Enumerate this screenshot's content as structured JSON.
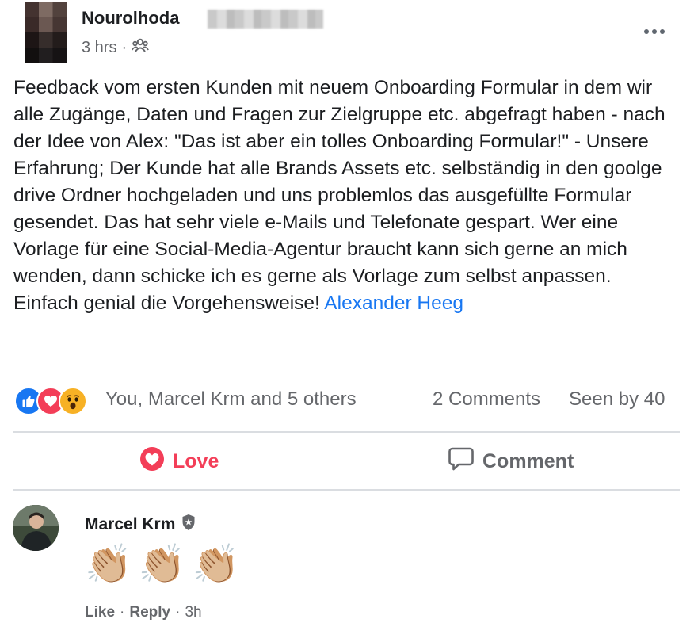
{
  "post": {
    "author": "Nourolhoda",
    "time": "3 hrs",
    "separator": "·",
    "text_main": "Feedback vom ersten Kunden mit neuem Onboarding Formular in dem wir alle Zugänge, Daten und Fragen zur Zielgruppe etc. abgefragt haben - nach der Idee von Alex: \"Das ist aber ein tolles Onboarding Formular!\" - Unsere Erfahrung; Der Kunde hat alle Brands Assets etc. selbständig in den goolge drive Ordner hochgeladen und uns problemlos das ausgefüllte Formular gesendet. Das hat sehr viele e-Mails und Telefonate gespart. Wer eine Vorlage für eine Social-Media-Agentur braucht kann sich gerne an mich wenden, dann schicke ich es gerne als Vorlage zum selbst anpassen. Einfach genial die Vorgehensweise!",
    "mention": "Alexander Heeg"
  },
  "stats": {
    "reactions_text": "You, Marcel Krm and 5 others",
    "comments": "2 Comments",
    "seen": "Seen by 40"
  },
  "actions": {
    "love_label": "Love",
    "comment_label": "Comment"
  },
  "comment": {
    "author": "Marcel Krm",
    "emoji": [
      "👏🏼",
      "👏🏼",
      "👏🏼"
    ],
    "like_label": "Like",
    "reply_label": "Reply",
    "time": "3h",
    "separator": "·"
  },
  "colors": {
    "love": "#f33e58",
    "link": "#1877f2",
    "secondary_text": "#65676b",
    "like_blue": "#1877f2",
    "wow_yellow": "#f7b125"
  },
  "icons": {
    "group": "group-privacy-icon",
    "more": "more-options-icon",
    "like": "like-reaction-icon",
    "love": "love-reaction-icon",
    "wow": "wow-reaction-icon",
    "comment": "comment-bubble-icon",
    "badge": "shield-badge-icon"
  }
}
